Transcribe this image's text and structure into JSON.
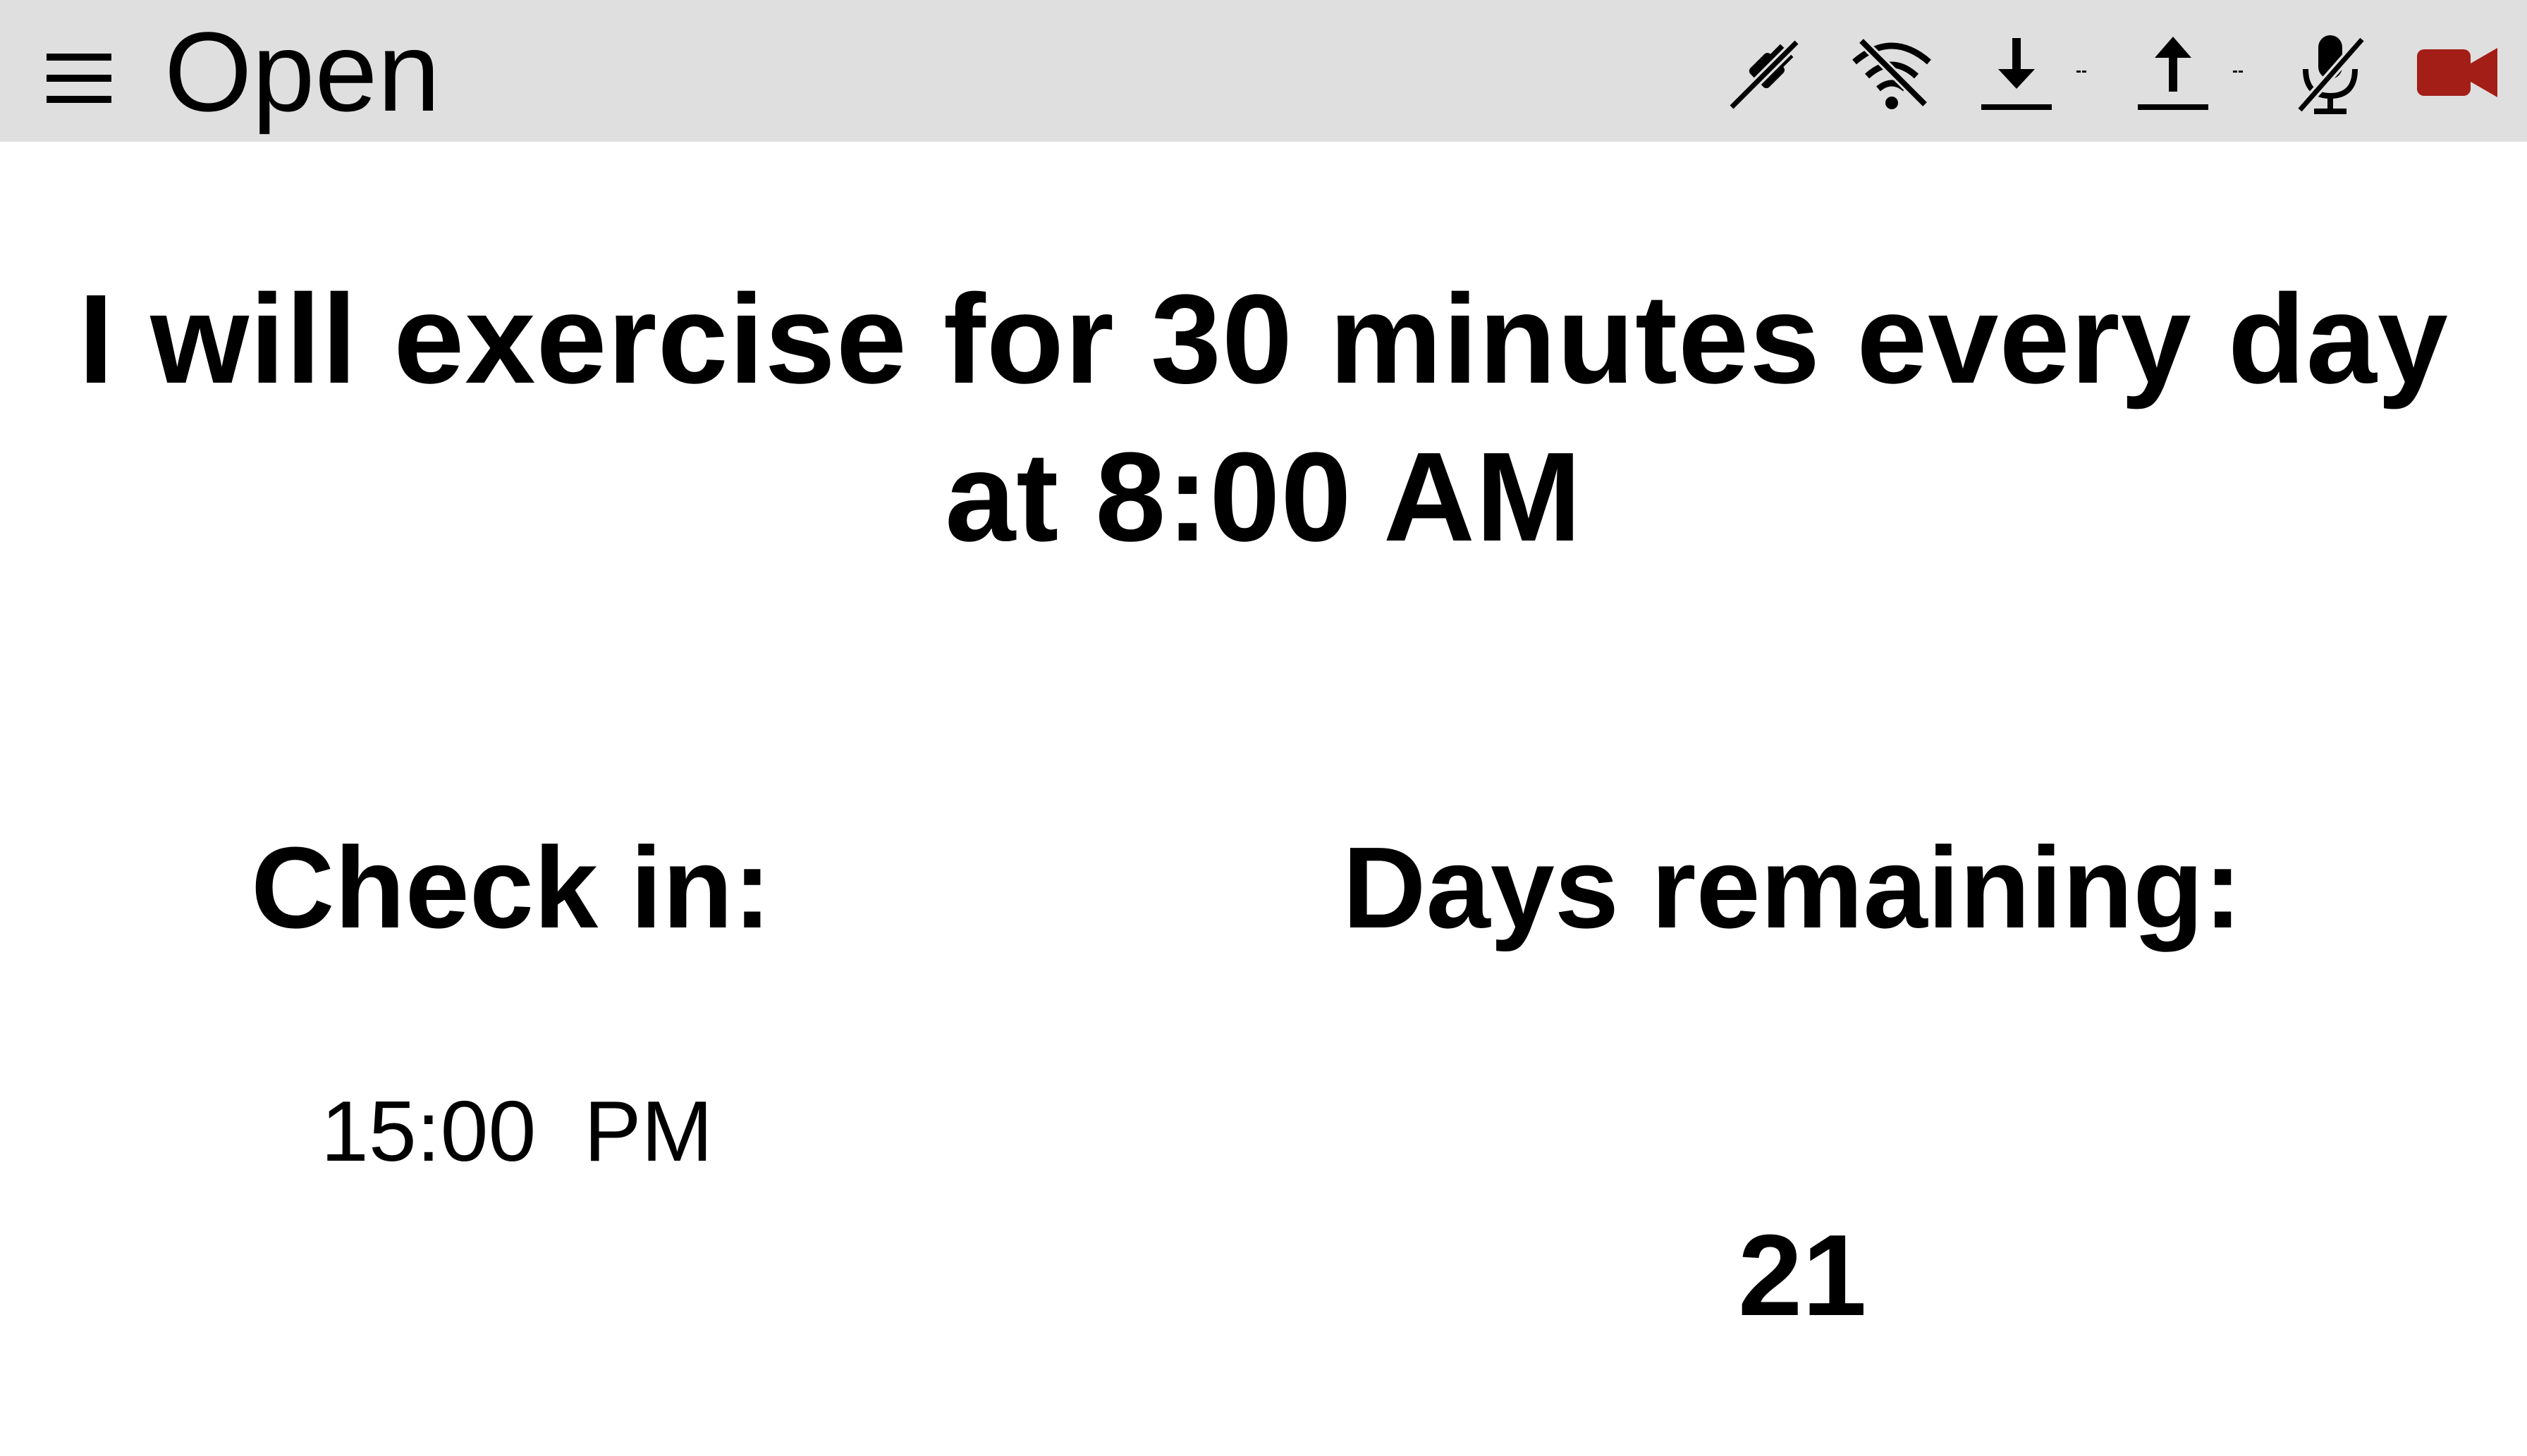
{
  "header": {
    "menu_icon": "hamburger-menu-icon",
    "title": "Open",
    "status_icons": {
      "connection": "plug-disconnected-icon",
      "wifi": "wifi-off-icon",
      "download": "download-arrow-icon",
      "download_rate": "--",
      "upload": "upload-arrow-icon",
      "upload_rate": "--",
      "microphone": "microphone-muted-icon",
      "camera": "video-camera-icon"
    },
    "colors": {
      "bar_background": "#dfdfdf",
      "camera_active": "#a31e16"
    }
  },
  "goal": {
    "line1": "I will exercise for 30 minutes every day",
    "line2": "at 8:00 AM"
  },
  "checkin": {
    "title": "Check in:",
    "time": "15:00  PM"
  },
  "days_remaining": {
    "title": "Days remaining:",
    "value": "21"
  }
}
